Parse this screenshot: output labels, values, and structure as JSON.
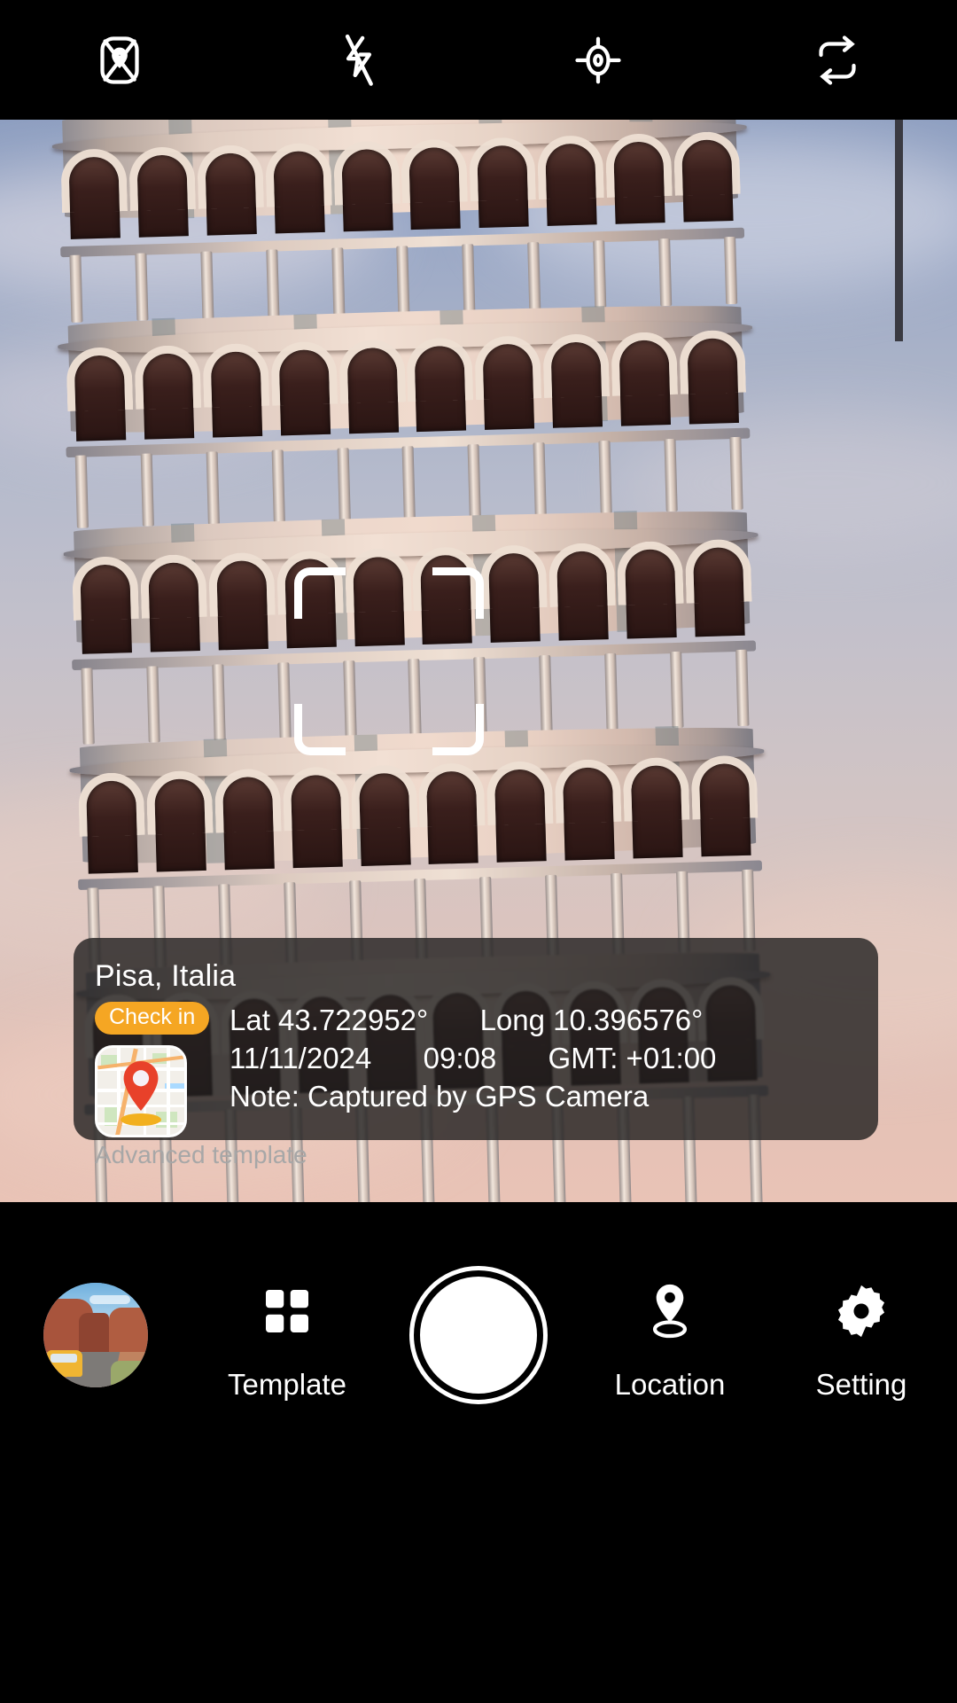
{
  "app": {
    "name": "GPS Camera"
  },
  "top_bar": {
    "icons": [
      {
        "name": "location-off-icon",
        "label": "Location stamp off"
      },
      {
        "name": "flash-off-icon",
        "label": "Flash off"
      },
      {
        "name": "focus-target-icon",
        "label": "Focus target"
      },
      {
        "name": "camera-switch-icon",
        "label": "Switch camera"
      }
    ]
  },
  "viewfinder": {
    "focus_frame": {
      "name": "focus-frame",
      "visible": true
    },
    "scene": "Leaning Tower of Pisa at dusk"
  },
  "info_card": {
    "place": "Pisa, Italia",
    "checkin_label": "Check in",
    "map_thumb_alt": "map-thumbnail",
    "lat": "Lat 43.722952°",
    "long": "Long 10.396576°",
    "date": "11/11/2024",
    "time": "09:08",
    "gmt": "GMT: +01:00",
    "note": "Note: Captured by GPS Camera",
    "template_label": "Advanced template",
    "accent_color": "#F5A623",
    "background_color": "rgba(32,31,31,0.80)"
  },
  "bottom_bar": {
    "gallery": {
      "name": "gallery-thumbnail",
      "label": ""
    },
    "template": {
      "label": "Template",
      "icon": "grid-icon"
    },
    "shutter": {
      "label": "",
      "icon": "shutter-icon"
    },
    "location": {
      "label": "Location",
      "icon": "map-pin-icon"
    },
    "setting": {
      "label": "Setting",
      "icon": "gear-icon"
    }
  }
}
